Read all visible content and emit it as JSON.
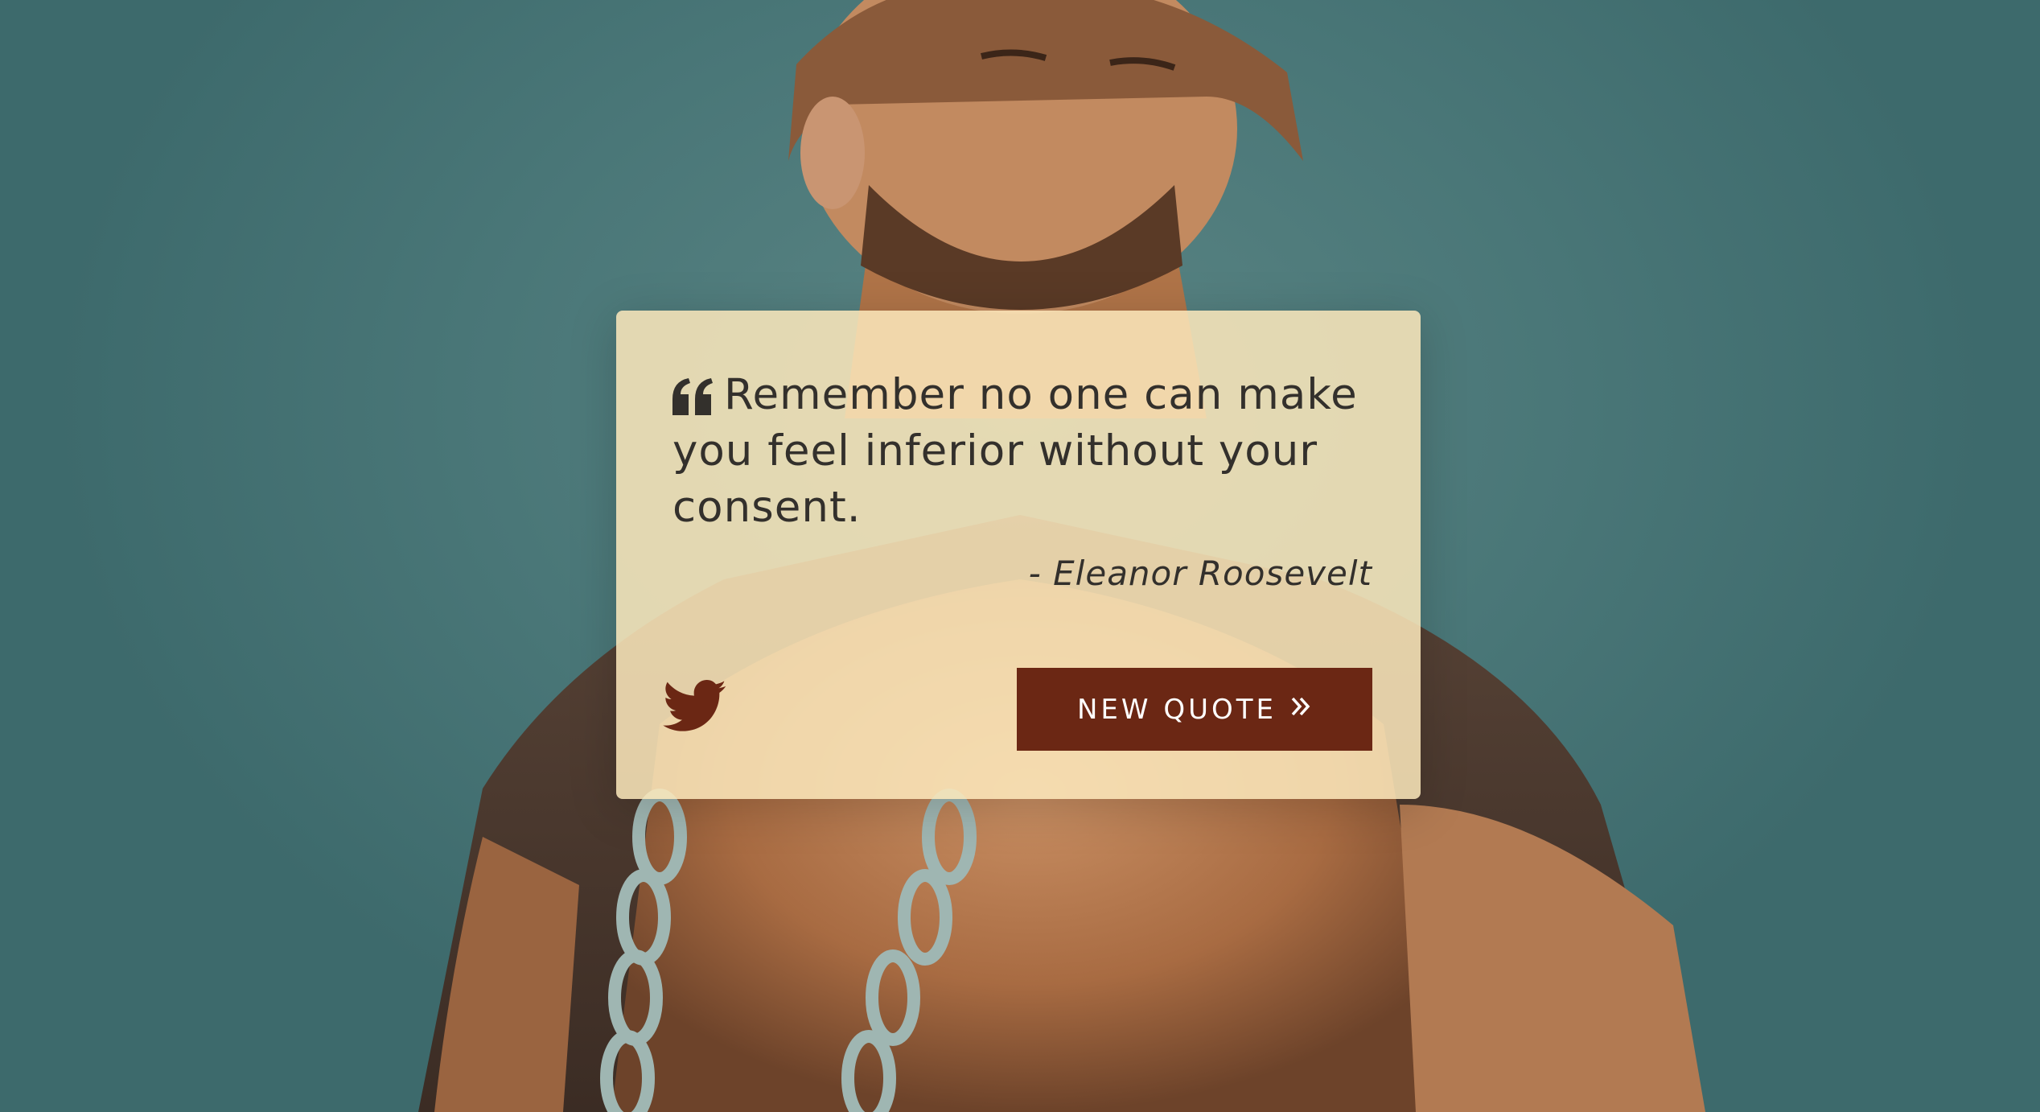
{
  "quote": {
    "text": "Remember no one can make you feel inferior without your consent.",
    "author": "- Eleanor Roosevelt",
    "icon": "quote-left-icon"
  },
  "actions": {
    "tweet_icon": "twitter-icon",
    "new_quote_label": "NEW QUOTE",
    "new_quote_icon": "double-chevron-right-icon"
  },
  "colors": {
    "card_background": "#fce8bc",
    "button_background": "#6b2714",
    "text": "#33302c",
    "sky": "#4f7c7d"
  }
}
